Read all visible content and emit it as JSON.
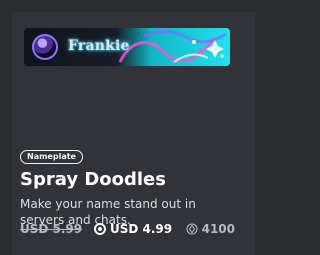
{
  "card": {
    "username": "Frankie",
    "badge": "Nameplate",
    "title": "Spray Doodles",
    "description": "Make your name stand out in servers and chats.",
    "price_original": "USD 5.99",
    "price_sale": "USD 4.99",
    "orbs_price": "4100",
    "colors": {
      "background": "#2b2d31",
      "card": "#313338",
      "accent": "#1ed6e2"
    },
    "icons": {
      "discount": "nitro-discount-icon",
      "orbs": "orbs-icon"
    }
  }
}
